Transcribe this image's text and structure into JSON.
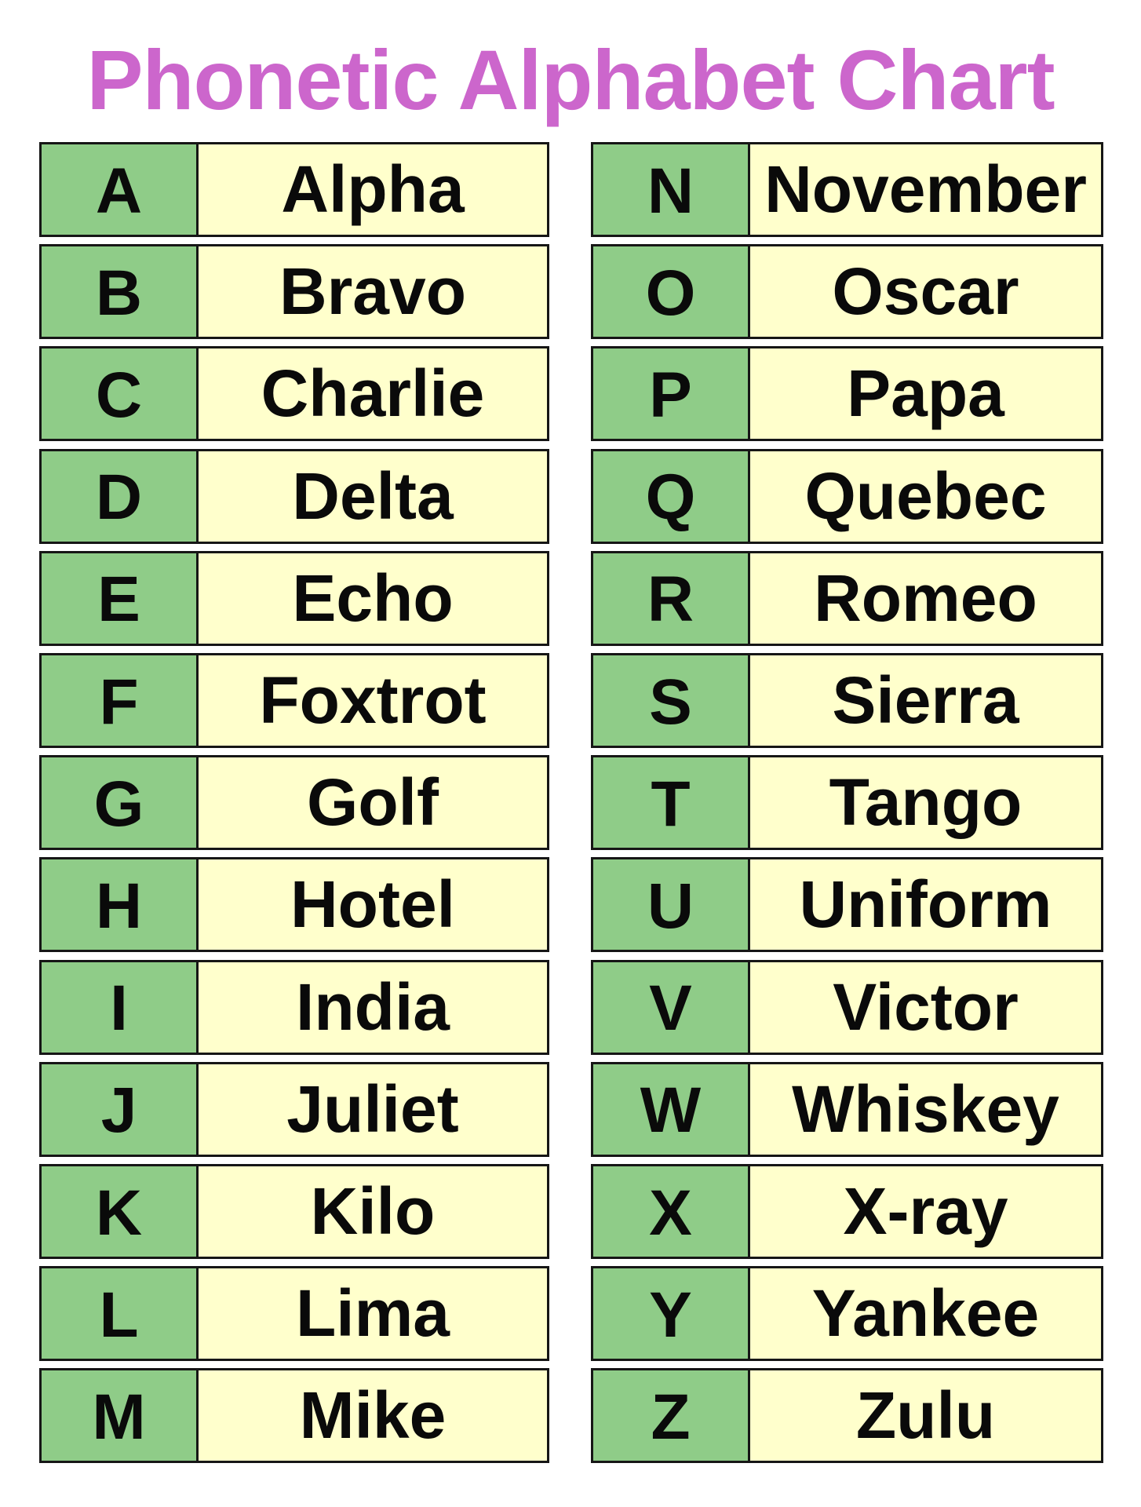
{
  "title": "Phonetic Alphabet Chart",
  "colors": {
    "title": "#CC66CC",
    "letter_cell": "#8FCC88",
    "word_cell": "#FFFFCC",
    "border": "#161616",
    "text": "#0a0a0a"
  },
  "left_column": [
    {
      "letter": "A",
      "word": "Alpha"
    },
    {
      "letter": "B",
      "word": "Bravo"
    },
    {
      "letter": "C",
      "word": "Charlie"
    },
    {
      "letter": "D",
      "word": "Delta"
    },
    {
      "letter": "E",
      "word": "Echo"
    },
    {
      "letter": "F",
      "word": "Foxtrot"
    },
    {
      "letter": "G",
      "word": "Golf"
    },
    {
      "letter": "H",
      "word": "Hotel"
    },
    {
      "letter": "I",
      "word": "India"
    },
    {
      "letter": "J",
      "word": "Juliet"
    },
    {
      "letter": "K",
      "word": "Kilo"
    },
    {
      "letter": "L",
      "word": "Lima"
    },
    {
      "letter": "M",
      "word": "Mike"
    }
  ],
  "right_column": [
    {
      "letter": "N",
      "word": "November"
    },
    {
      "letter": "O",
      "word": "Oscar"
    },
    {
      "letter": "P",
      "word": "Papa"
    },
    {
      "letter": "Q",
      "word": "Quebec"
    },
    {
      "letter": "R",
      "word": "Romeo"
    },
    {
      "letter": "S",
      "word": "Sierra"
    },
    {
      "letter": "T",
      "word": "Tango"
    },
    {
      "letter": "U",
      "word": "Uniform"
    },
    {
      "letter": "V",
      "word": "Victor"
    },
    {
      "letter": "W",
      "word": "Whiskey"
    },
    {
      "letter": "X",
      "word": "X-ray"
    },
    {
      "letter": "Y",
      "word": "Yankee"
    },
    {
      "letter": "Z",
      "word": "Zulu"
    }
  ]
}
